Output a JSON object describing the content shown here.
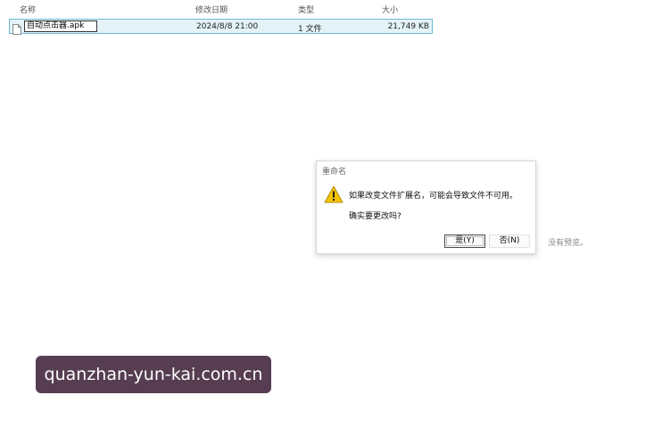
{
  "columns": {
    "name": "名称",
    "date": "修改日期",
    "type": "类型",
    "size": "大小"
  },
  "file": {
    "name": "自动点击器.apk",
    "date": "2024/8/8 21:00",
    "type": "1 文件",
    "size": "21,749 KB",
    "icon": "document-icon"
  },
  "dialog": {
    "title": "重命名",
    "icon": "warning-icon",
    "message": "如果改变文件扩展名，可能会导致文件不可用。",
    "question": "确实要更改吗?",
    "yes_label": "是(Y)",
    "no_label": "否(N)"
  },
  "preview": {
    "empty_text": "没有预览。"
  },
  "watermark": {
    "text": "quanzhan-yun-kai.com.cn"
  },
  "colors": {
    "selection_bg": "#e3f3f8",
    "selection_border": "#6fb8d2",
    "warning_yellow": "#f5c400",
    "watermark_bg": "#482c42"
  }
}
